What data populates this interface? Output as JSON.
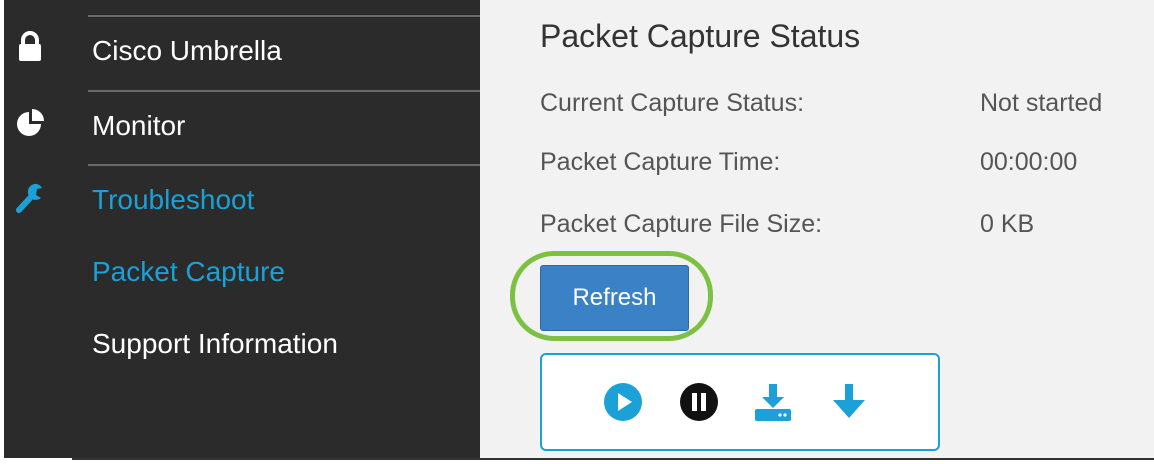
{
  "sidebar": {
    "items": [
      {
        "label": "Cisco Umbrella",
        "icon": "lock-icon"
      },
      {
        "label": "Monitor",
        "icon": "pie-chart-icon"
      },
      {
        "label": "Troubleshoot",
        "icon": "wrench-icon"
      },
      {
        "label": "Packet Capture"
      },
      {
        "label": "Support Information"
      }
    ],
    "active_color": "#1ba0d8"
  },
  "main": {
    "title": "Packet Capture Status",
    "rows": [
      {
        "label": "Current Capture Status:",
        "value": "Not started"
      },
      {
        "label": "Packet Capture Time:",
        "value": "00:00:00"
      },
      {
        "label": "Packet Capture File Size:",
        "value": "0 KB"
      }
    ],
    "refresh_label": "Refresh",
    "highlight_color": "#7cc142",
    "toolbar": [
      "play-icon",
      "pause-icon",
      "download-to-device-icon",
      "download-arrow-icon"
    ]
  }
}
